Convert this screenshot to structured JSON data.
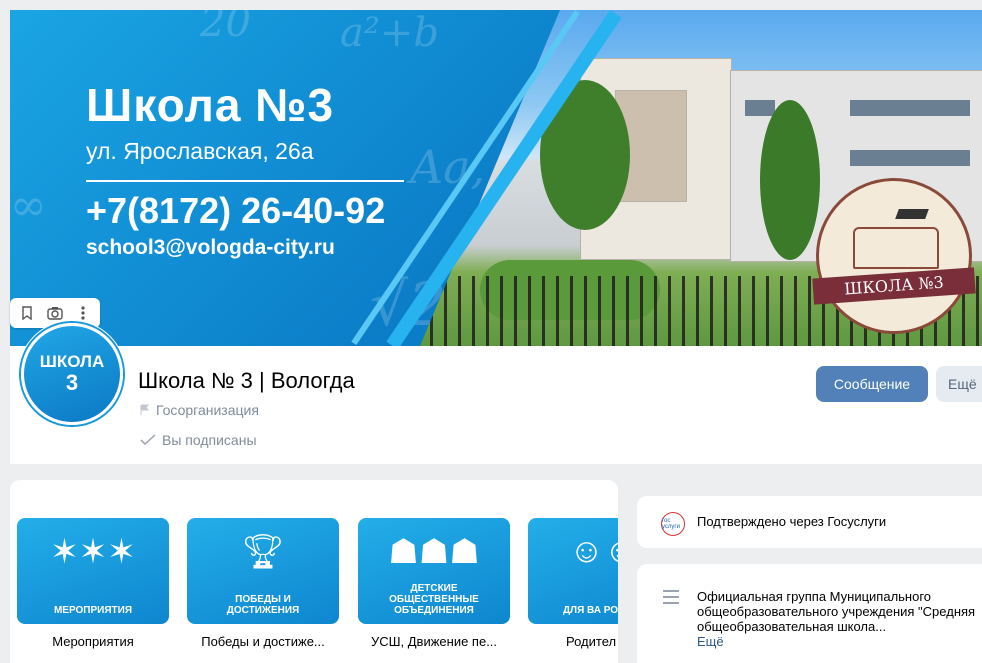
{
  "banner": {
    "title": "Школа №3",
    "address": "ул. Ярославская, 26а",
    "phone": "+7(8172) 26-40-92",
    "email": "school3@vologda-city.ru",
    "seal_text": "ШКОЛА №3",
    "tools": [
      "bookmark-icon",
      "camera-icon",
      "more-vertical-icon"
    ]
  },
  "group": {
    "avatar_line1": "ШКОЛА",
    "avatar_line2": "3",
    "name": "Школа № 3 | Вологда",
    "type": "Госорганизация",
    "subscribed": "Вы подписаны",
    "message_button": "Сообщение",
    "more_button": "Ещё"
  },
  "sections": [
    {
      "tile_caption": "МЕРОПРИЯТИЯ",
      "label": "Мероприятия"
    },
    {
      "tile_caption": "ПОБЕДЫ И ДОСТИЖЕНИЯ",
      "label": "Победы и достиже..."
    },
    {
      "tile_caption": "ДЕТСКИЕ ОБЩЕСТВЕННЫЕ ОБЪЕДИНЕНИЯ",
      "label": "УСШ, Движение пе..."
    },
    {
      "tile_caption": "ДЛЯ ВА РОДИТЕ",
      "label": "Родител"
    }
  ],
  "sidebar": {
    "gosuslugi_icon_text": "гос услуги",
    "verified_text": "Подтверждено через Госуслуги",
    "description": "Официальная группа Муниципального общеобразовательного учреждения \"Средняя общеобразовательная школа...",
    "more_link": "Ещё"
  },
  "colors": {
    "accent": "#5181b8",
    "banner_blue": "#0b7cc7",
    "link": "#2a5885"
  }
}
